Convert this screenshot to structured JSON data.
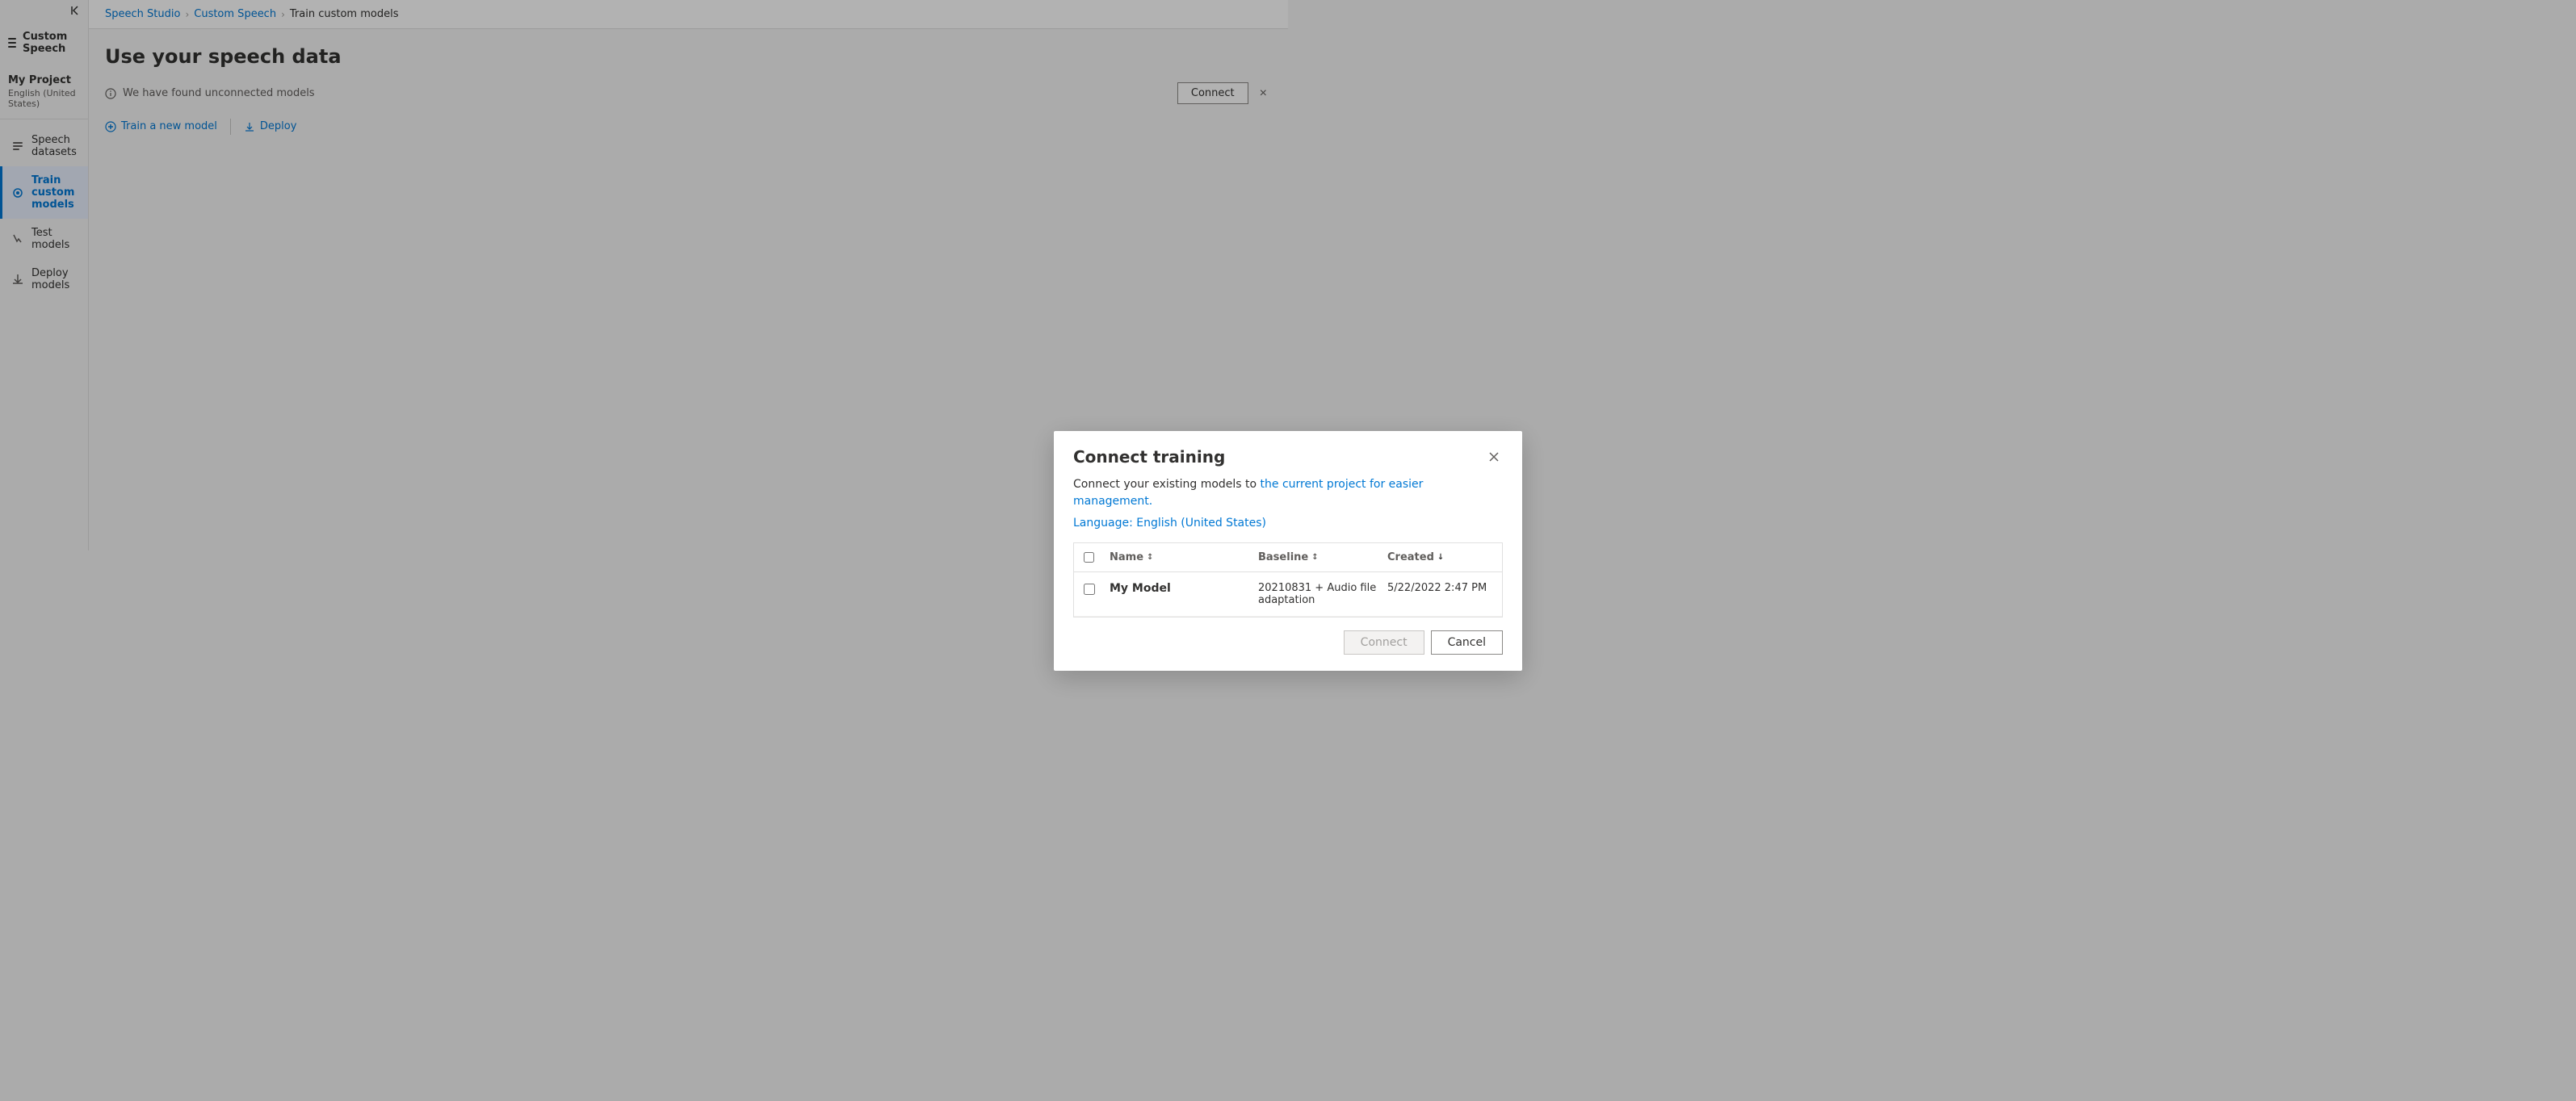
{
  "breadcrumb": {
    "items": [
      {
        "label": "Speech Studio",
        "link": true
      },
      {
        "label": "Custom Speech",
        "link": true
      },
      {
        "label": "Train custom models",
        "link": false
      }
    ],
    "separators": [
      ">",
      ">"
    ]
  },
  "sidebar": {
    "collapse_label": "Collapse",
    "app_title": "Custom Speech",
    "project": {
      "name": "My Project",
      "language": "English (United States)"
    },
    "nav_items": [
      {
        "id": "speech-datasets",
        "label": "Speech datasets",
        "icon": "dataset-icon",
        "active": false
      },
      {
        "id": "train-custom-models",
        "label": "Train custom models",
        "icon": "train-icon",
        "active": true
      },
      {
        "id": "test-models",
        "label": "Test models",
        "icon": "test-icon",
        "active": false
      },
      {
        "id": "deploy-models",
        "label": "Deploy models",
        "icon": "deploy-icon",
        "active": false
      }
    ]
  },
  "page": {
    "title": "Use your speech data",
    "info_bar": {
      "message": "We have found unconnected models",
      "connect_label": "Connect",
      "close_label": "×"
    },
    "toolbar": {
      "train_new_model": "Train a new model",
      "deploy": "Deploy"
    }
  },
  "dialog": {
    "title": "Connect training",
    "description": "Connect your existing models to the current project for easier management.",
    "description_link_text": "the current project for easier management.",
    "language_label": "Language:",
    "language_value": "English (United States)",
    "table": {
      "columns": [
        {
          "id": "checkbox",
          "label": ""
        },
        {
          "id": "name",
          "label": "Name",
          "sortable": true,
          "sort": "asc_desc"
        },
        {
          "id": "baseline",
          "label": "Baseline",
          "sortable": true,
          "sort": "asc_desc"
        },
        {
          "id": "created",
          "label": "Created",
          "sortable": true,
          "sort": "desc"
        }
      ],
      "rows": [
        {
          "name": "My Model",
          "baseline": "20210831 + Audio file adaptation",
          "created": "5/22/2022 2:47 PM",
          "checked": false
        }
      ]
    },
    "footer": {
      "connect_label": "Connect",
      "cancel_label": "Cancel"
    }
  }
}
